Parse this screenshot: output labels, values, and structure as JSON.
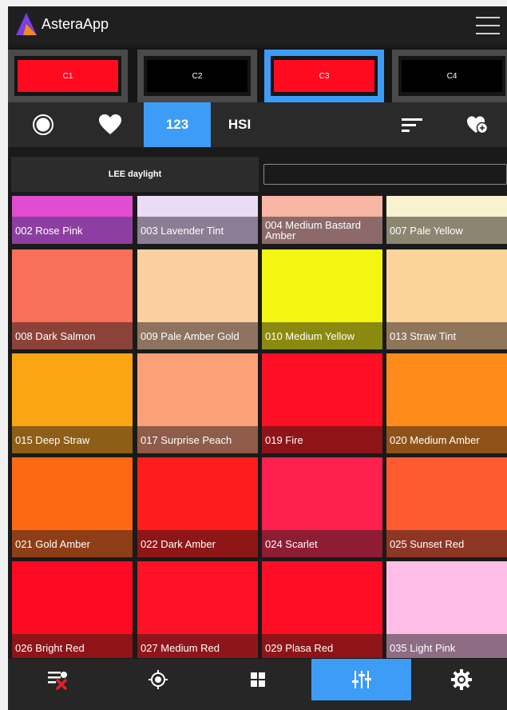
{
  "app": {
    "title": "AsteraApp"
  },
  "cues": [
    {
      "label": "C1",
      "color": "#ff0a1e",
      "active": false
    },
    {
      "label": "C2",
      "color": "#000000",
      "active": false
    },
    {
      "label": "C3",
      "color": "#ff0a1e",
      "active": true
    },
    {
      "label": "C4",
      "color": "#000000",
      "active": false
    }
  ],
  "toolbar": {
    "items": [
      {
        "name": "color-wheel-icon"
      },
      {
        "name": "heart-icon"
      },
      {
        "label": "123",
        "active": true
      },
      {
        "label": "HSI"
      },
      {
        "name": "sort-icon"
      },
      {
        "name": "add-favorite-icon"
      }
    ]
  },
  "filter": {
    "library_label": "LEE daylight",
    "search_placeholder": ""
  },
  "swatches": [
    {
      "label": "002 Rose Pink",
      "color": "#e04dd2",
      "label_bg": "#8c3fa0"
    },
    {
      "label": "003 Lavender Tint",
      "color": "#ebdcf5",
      "label_bg": "#8a7d94"
    },
    {
      "label": "004 Medium Bastard Amber",
      "color": "#f8b6a4",
      "label_bg": "#8c6a6a"
    },
    {
      "label": "007 Pale Yellow",
      "color": "#f9f2cf",
      "label_bg": "#8c8670"
    },
    {
      "label": "008 Dark Salmon",
      "color": "#f86f5a",
      "label_bg": "#8c4238"
    },
    {
      "label": "009 Pale Amber Gold",
      "color": "#fbcfa0",
      "label_bg": "#8d7360"
    },
    {
      "label": "010 Medium Yellow",
      "color": "#f5f512",
      "label_bg": "#8a8a10"
    },
    {
      "label": "013 Straw Tint",
      "color": "#fcd49a",
      "label_bg": "#8f765a"
    },
    {
      "label": "015 Deep Straw",
      "color": "#fca513",
      "label_bg": "#8e5e16"
    },
    {
      "label": "017 Surprise Peach",
      "color": "#fca07a",
      "label_bg": "#8e5c48"
    },
    {
      "label": "019 Fire",
      "color": "#ff0f23",
      "label_bg": "#8e1418"
    },
    {
      "label": "020 Medium Amber",
      "color": "#ff8c1a",
      "label_bg": "#8e5218"
    },
    {
      "label": "021 Gold Amber",
      "color": "#ff6812",
      "label_bg": "#8e3e16"
    },
    {
      "label": "022 Dark Amber",
      "color": "#ff1c1c",
      "label_bg": "#8e1616"
    },
    {
      "label": "024 Scarlet",
      "color": "#ff2050",
      "label_bg": "#8e1c34"
    },
    {
      "label": "025 Sunset Red",
      "color": "#ff5a30",
      "label_bg": "#8e3624"
    },
    {
      "label": "026 Bright Red",
      "color": "#ff0a23",
      "label_bg": "#8e1418"
    },
    {
      "label": "027 Medium Red",
      "color": "#ff1227",
      "label_bg": "#8e161b"
    },
    {
      "label": "029 Plasa Red",
      "color": "#ff0d24",
      "label_bg": "#8e1418"
    },
    {
      "label": "035 Light Pink",
      "color": "#fdbde6",
      "label_bg": "#8e6c84"
    }
  ],
  "bottom_nav": [
    {
      "name": "clear-list-icon"
    },
    {
      "name": "target-icon"
    },
    {
      "name": "grid-icon"
    },
    {
      "name": "sliders-icon",
      "active": true
    },
    {
      "name": "settings-icon"
    }
  ],
  "colors": {
    "accent": "#3d9cf5",
    "background": "#1a1a1a",
    "remove": "#e0242a"
  }
}
